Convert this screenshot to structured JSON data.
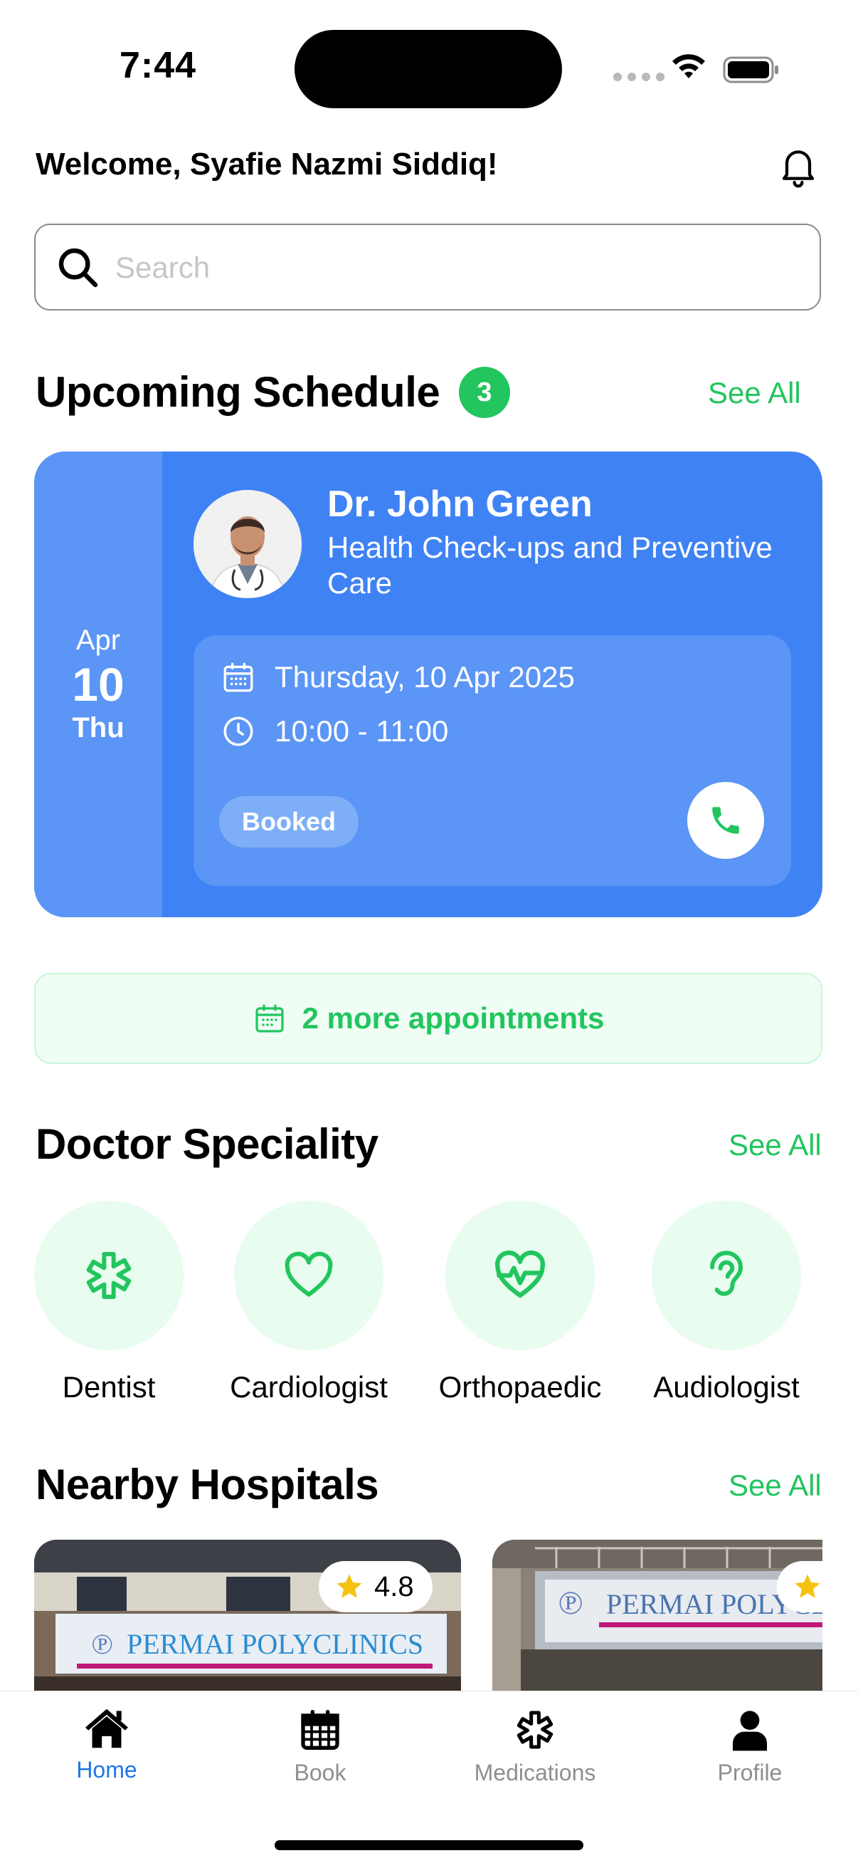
{
  "status_bar": {
    "time": "7:44"
  },
  "header": {
    "welcome": "Welcome, Syafie Nazmi Siddiq!"
  },
  "search": {
    "placeholder": "Search",
    "value": ""
  },
  "schedule": {
    "title": "Upcoming Schedule",
    "count": "3",
    "see_all": "See All",
    "card": {
      "month": "Apr",
      "day": "10",
      "weekday": "Thu",
      "doctor_name": "Dr. John Green",
      "specialty": "Health Check-ups and Preventive Care",
      "date": "Thursday, 10 Apr 2025",
      "time": "10:00 - 11:00",
      "status": "Booked"
    },
    "more_label": "2 more appointments"
  },
  "specialities": {
    "title": "Doctor Speciality",
    "see_all": "See All",
    "items": [
      {
        "label": "Dentist",
        "icon": "asterisk-icon"
      },
      {
        "label": "Cardiologist",
        "icon": "heart-icon"
      },
      {
        "label": "Orthopaedic",
        "icon": "heart-pulse-icon"
      },
      {
        "label": "Audiologist",
        "icon": "ear-icon"
      }
    ]
  },
  "hospitals": {
    "title": "Nearby Hospitals",
    "see_all": "See All",
    "items": [
      {
        "sign": "PERMAI POLYCLINICS",
        "rating": "4.8"
      },
      {
        "sign": "PERMAI POLYCLINICS"
      }
    ]
  },
  "tabbar": {
    "items": [
      {
        "label": "Home",
        "icon": "home-icon",
        "active": true
      },
      {
        "label": "Book",
        "icon": "calendar-icon",
        "active": false
      },
      {
        "label": "Medications",
        "icon": "asterisk-icon",
        "active": false
      },
      {
        "label": "Profile",
        "icon": "person-icon",
        "active": false
      }
    ]
  },
  "colors": {
    "accent_green": "#22c55e",
    "card_blue": "#3f82f4",
    "tab_active": "#1f77e6"
  }
}
